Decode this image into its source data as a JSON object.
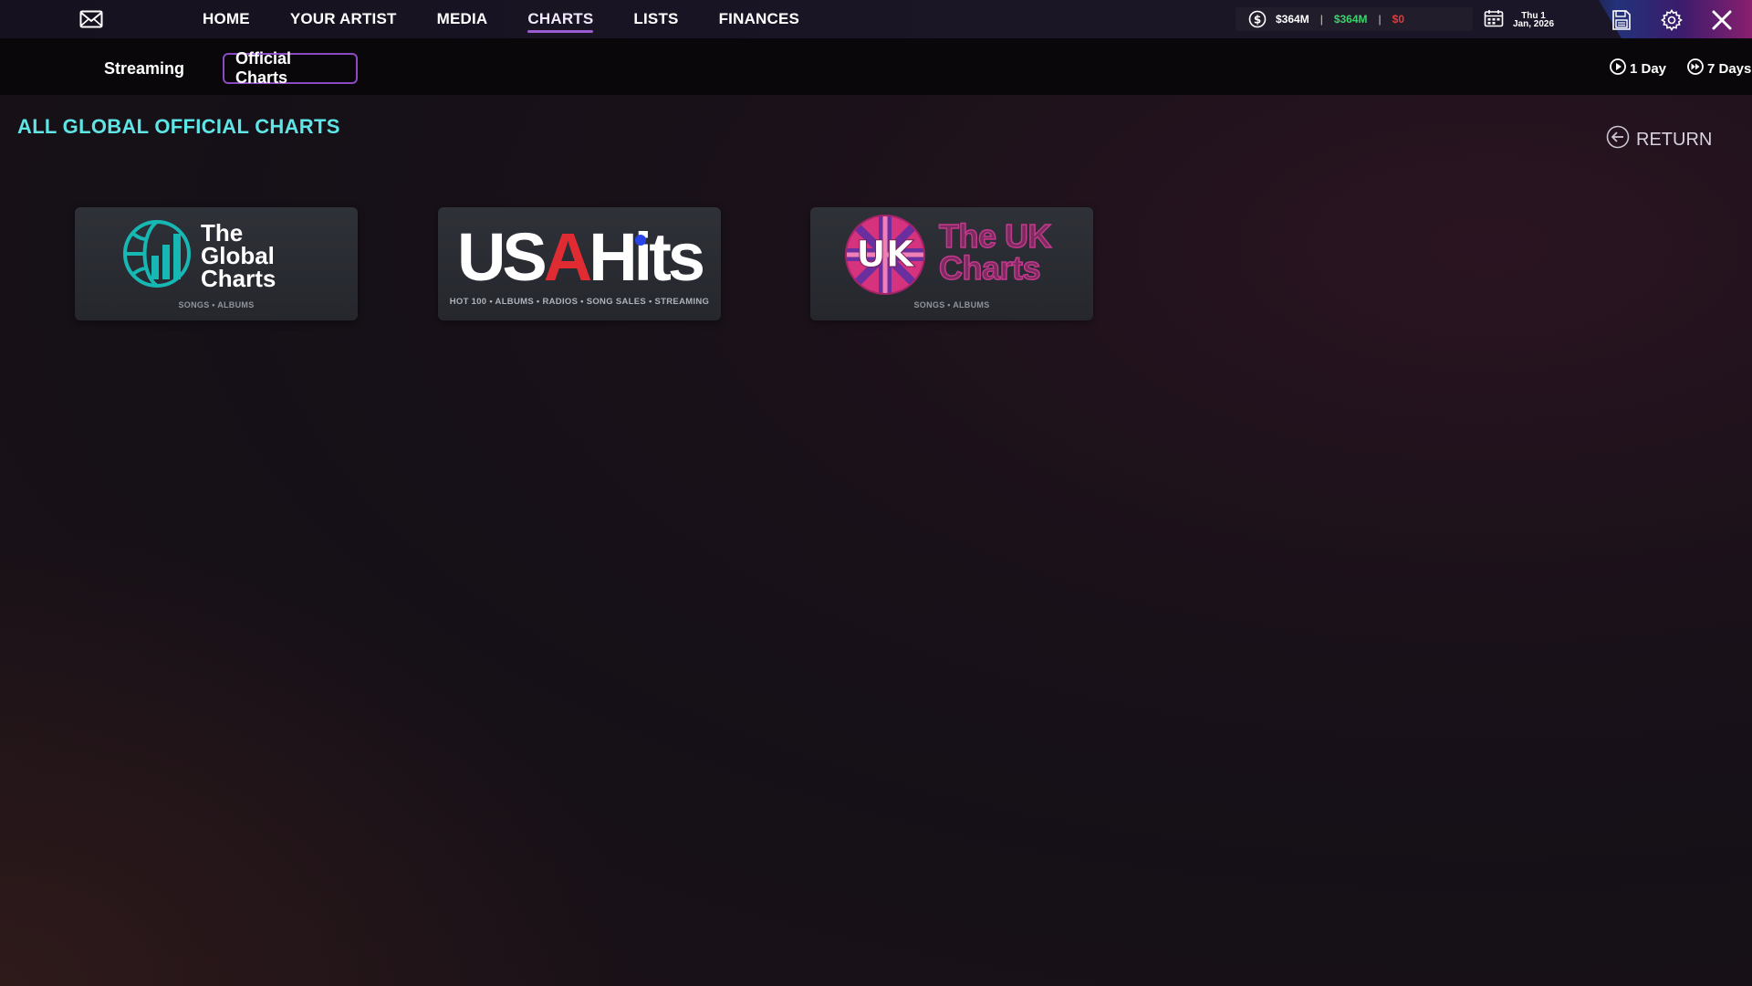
{
  "topbar": {
    "nav": [
      {
        "label": "HOME"
      },
      {
        "label": "YOUR ARTIST"
      },
      {
        "label": "MEDIA"
      },
      {
        "label": "CHARTS",
        "active": true
      },
      {
        "label": "LISTS"
      },
      {
        "label": "FINANCES"
      }
    ],
    "money": {
      "balance": "$364M",
      "income": "$364M",
      "expense": "$0"
    },
    "date": {
      "day": "Thu 1",
      "month_year": "Jan, 2026"
    }
  },
  "subbar": {
    "tabs": [
      {
        "label": "Streaming"
      },
      {
        "label": "Official Charts",
        "active": true
      }
    ],
    "time_controls": [
      {
        "label": "1 Day"
      },
      {
        "label": "7 Days"
      }
    ]
  },
  "main": {
    "title": "ALL GLOBAL OFFICIAL CHARTS",
    "return_label": "RETURN",
    "cards": [
      {
        "title_lines": [
          "The",
          "Global",
          "Charts"
        ],
        "subtitle": "SONGS • ALBUMS"
      },
      {
        "title_parts": [
          "USA",
          "A",
          "Hits"
        ],
        "subtitle": "HOT 100 • ALBUMS • RADIOS • SONG SALES • STREAMING"
      },
      {
        "title_lines": [
          "The UK",
          "Charts"
        ],
        "badge": "UK",
        "subtitle": "SONGS • ALBUMS"
      }
    ]
  },
  "colors": {
    "accent_purple": "#8a4bc2",
    "title_cyan": "#5fe5e6",
    "income_green": "#38d36a",
    "expense_red": "#e43a3a",
    "global_teal": "#17b8b3",
    "usa_red": "#e12b33",
    "usa_blue": "#2846e8",
    "uk_pink": "#d6337f"
  }
}
